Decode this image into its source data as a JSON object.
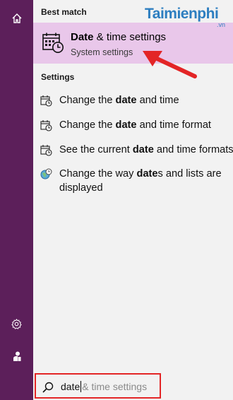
{
  "rail": {
    "home_icon": "home-icon",
    "settings_icon": "gear-icon",
    "user_icon": "user-icon"
  },
  "sections": {
    "best_match": "Best match",
    "settings": "Settings"
  },
  "best_match": {
    "title_bold": "Date",
    "title_rest": " & time settings",
    "subtitle": "System settings",
    "icon": "calendar-clock-icon"
  },
  "results": [
    {
      "pre": "Change the ",
      "bold": "date",
      "post": " and time",
      "icon": "calendar-clock-icon"
    },
    {
      "pre": "Change the ",
      "bold": "date",
      "post": " and time format",
      "icon": "calendar-clock-icon"
    },
    {
      "pre": "See the current ",
      "bold": "date",
      "post": " and time formats",
      "icon": "calendar-clock-icon"
    },
    {
      "pre": "Change the way ",
      "bold": "date",
      "post": "s and lists are displayed",
      "icon": "globe-clock-icon"
    }
  ],
  "search": {
    "typed": "date",
    "suggestion": "& time settings",
    "icon": "search-icon"
  },
  "watermark": {
    "main": "Taimienphi",
    "sub": ".vn"
  },
  "colors": {
    "rail": "#5c1f5a",
    "highlight": "#e9c7ea",
    "annotation_red": "#e32526",
    "watermark_blue": "#2d7ec0"
  }
}
